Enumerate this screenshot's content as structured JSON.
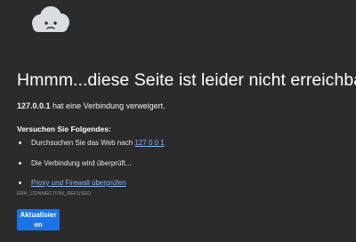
{
  "page": {
    "icon": "sad-cloud-icon",
    "title": "Hmmm...diese Seite ist leider nicht erreichbar",
    "summary": {
      "host": "127.0.0.1",
      "message": " hat eine Verbindung verweigert."
    },
    "suggestions_heading": "Versuchen Sie Folgendes:",
    "suggestions": [
      {
        "prefix": "Durchsuchen Sie das Web nach ",
        "link": "127 0 0 1"
      },
      {
        "text": "Die Verbindung wird überprüft..."
      },
      {
        "link": "Proxy und Firewall überprüfen"
      }
    ],
    "error_code": "ERR_CONNECTION_REFUSED",
    "reload_label": "Aktualisieren"
  },
  "colors": {
    "background": "#2b2b2b",
    "link": "#8ab4f8",
    "button": "#1a73e8",
    "icon": "#d9dde1"
  }
}
